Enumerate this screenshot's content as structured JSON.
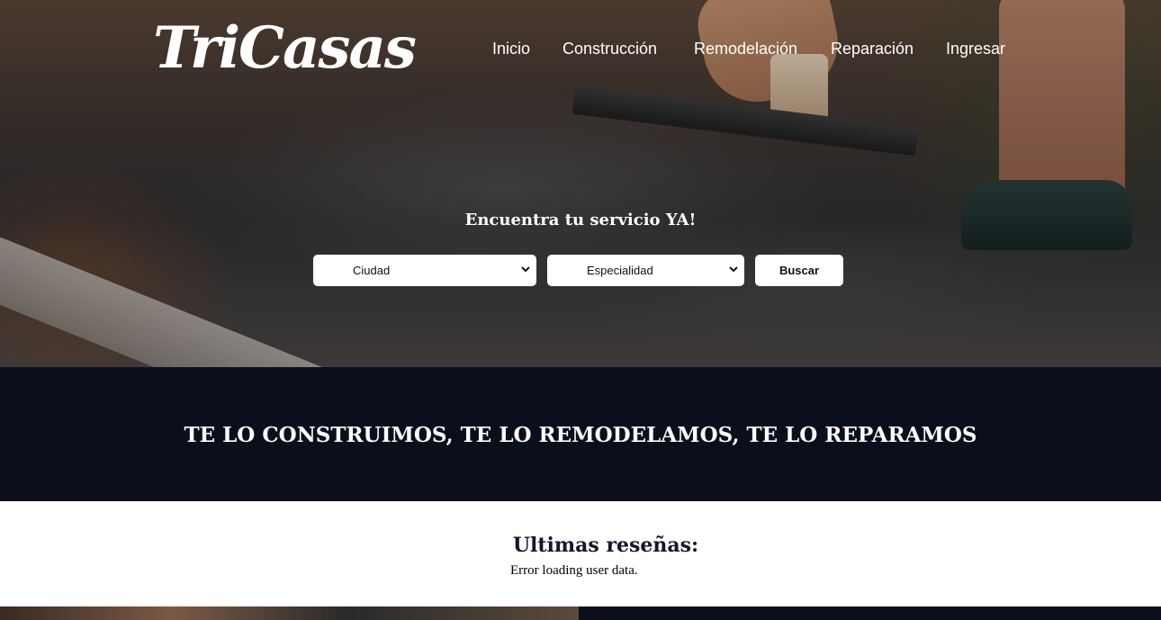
{
  "brand": {
    "logo_text": "TriCasas"
  },
  "nav": {
    "items": [
      {
        "label": "Inicio"
      },
      {
        "label": "Construcción"
      },
      {
        "label": "Remodelación"
      },
      {
        "label": "Reparación"
      },
      {
        "label": "Ingresar"
      }
    ]
  },
  "search": {
    "title": "Encuentra tu servicio YA!",
    "city_select": {
      "selected": "Ciudad"
    },
    "specialty_select": {
      "selected": "Especialidad"
    },
    "button_label": "Buscar"
  },
  "banner": {
    "text": "TE LO CONSTRUIMOS, TE LO REMODELAMOS, TE LO REPARAMOS"
  },
  "reviews": {
    "title": "Ultimas reseñas:",
    "error_message": "Error loading user data."
  },
  "colors": {
    "banner_bg": "#0b0f1c",
    "heading_text": "#12182a",
    "hero_text": "#ffffff"
  },
  "icons": [
    "chevron-down-icon"
  ]
}
